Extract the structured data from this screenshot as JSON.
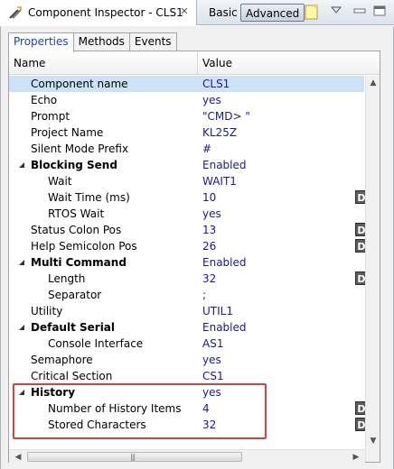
{
  "view": {
    "title": "Component Inspector - CLS1",
    "close_glyph": "✕",
    "modes": {
      "basic": "Basic",
      "advanced": "Advanced"
    }
  },
  "tabs": [
    "Properties",
    "Methods",
    "Events"
  ],
  "columns": {
    "name": "Name",
    "value": "Value"
  },
  "rows": [
    {
      "name": "Component name",
      "value": "CLS1",
      "indent": 1,
      "bold": false,
      "expander": false,
      "d": false,
      "selected": true
    },
    {
      "name": "Echo",
      "value": "yes",
      "indent": 1,
      "bold": false,
      "expander": false,
      "d": false
    },
    {
      "name": "Prompt",
      "value": "\"CMD> \"",
      "indent": 1,
      "bold": false,
      "expander": false,
      "d": false
    },
    {
      "name": "Project Name",
      "value": "KL25Z",
      "indent": 1,
      "bold": false,
      "expander": false,
      "d": false
    },
    {
      "name": "Silent Mode Prefix",
      "value": "#",
      "indent": 1,
      "bold": false,
      "expander": false,
      "d": false
    },
    {
      "name": "Blocking Send",
      "value": "Enabled",
      "indent": 1,
      "bold": true,
      "expander": true,
      "d": false
    },
    {
      "name": "Wait",
      "value": "WAIT1",
      "indent": 2,
      "bold": false,
      "expander": false,
      "d": false
    },
    {
      "name": "Wait Time (ms)",
      "value": "10",
      "indent": 2,
      "bold": false,
      "expander": false,
      "d": true
    },
    {
      "name": "RTOS Wait",
      "value": "yes",
      "indent": 2,
      "bold": false,
      "expander": false,
      "d": false
    },
    {
      "name": "Status Colon Pos",
      "value": "13",
      "indent": 1,
      "bold": false,
      "expander": false,
      "d": true
    },
    {
      "name": "Help Semicolon Pos",
      "value": "26",
      "indent": 1,
      "bold": false,
      "expander": false,
      "d": true
    },
    {
      "name": "Multi Command",
      "value": "Enabled",
      "indent": 1,
      "bold": true,
      "expander": true,
      "d": false
    },
    {
      "name": "Length",
      "value": "32",
      "indent": 2,
      "bold": false,
      "expander": false,
      "d": true
    },
    {
      "name": "Separator",
      "value": ";",
      "indent": 2,
      "bold": false,
      "expander": false,
      "d": false
    },
    {
      "name": "Utility",
      "value": "UTIL1",
      "indent": 1,
      "bold": false,
      "expander": false,
      "d": false
    },
    {
      "name": "Default Serial",
      "value": "Enabled",
      "indent": 1,
      "bold": true,
      "expander": true,
      "d": false
    },
    {
      "name": "Console Interface",
      "value": "AS1",
      "indent": 2,
      "bold": false,
      "expander": false,
      "d": false
    },
    {
      "name": "Semaphore",
      "value": "yes",
      "indent": 1,
      "bold": false,
      "expander": false,
      "d": false
    },
    {
      "name": "Critical Section",
      "value": "CS1",
      "indent": 1,
      "bold": false,
      "expander": false,
      "d": false
    },
    {
      "name": "History",
      "value": "yes",
      "indent": 1,
      "bold": true,
      "expander": true,
      "d": false
    },
    {
      "name": "Number of History Items",
      "value": "4",
      "indent": 2,
      "bold": false,
      "expander": false,
      "d": true
    },
    {
      "name": "Stored Characters",
      "value": "32",
      "indent": 2,
      "bold": false,
      "expander": false,
      "d": true
    }
  ],
  "d_label": "D",
  "scroll_grip": "|||",
  "colors": {
    "value_text": "#1a1a8c",
    "selected_row": "#cde2f7",
    "highlight": "#d9413b",
    "d_button": "#5c5c5c"
  }
}
